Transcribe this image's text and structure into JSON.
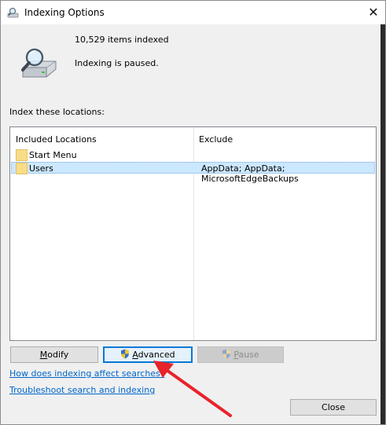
{
  "window": {
    "title": "Indexing Options",
    "close_glyph": "✕"
  },
  "status": {
    "items_indexed": "10,529 items indexed",
    "state": "Indexing is paused."
  },
  "locations": {
    "label": "Index these locations:",
    "columns": {
      "included": "Included Locations",
      "exclude": "Exclude"
    },
    "rows": [
      {
        "location": "Start Menu",
        "exclude": "",
        "selected": false
      },
      {
        "location": "Users",
        "exclude": "AppData; AppData; MicrosoftEdgeBackups",
        "selected": true
      }
    ]
  },
  "buttons": {
    "modify": {
      "prefix": "",
      "underlined": "M",
      "rest": "odify"
    },
    "advanced": {
      "prefix": "",
      "underlined": "A",
      "rest": "dvanced"
    },
    "pause": {
      "prefix": "",
      "underlined": "P",
      "rest": "ause"
    },
    "close": "Close"
  },
  "links": {
    "affect": "How does indexing affect searches?",
    "troubleshoot": "Troubleshoot search and indexing"
  },
  "colors": {
    "accent": "#0078d7",
    "link": "#0066cc",
    "selection": "#cce8ff",
    "annotation_arrow": "#e8232a"
  },
  "icons": [
    "indexing-options-icon",
    "magnifier-drive-icon",
    "folder-icon",
    "uac-shield-icon",
    "close-icon",
    "annotation-arrow"
  ]
}
